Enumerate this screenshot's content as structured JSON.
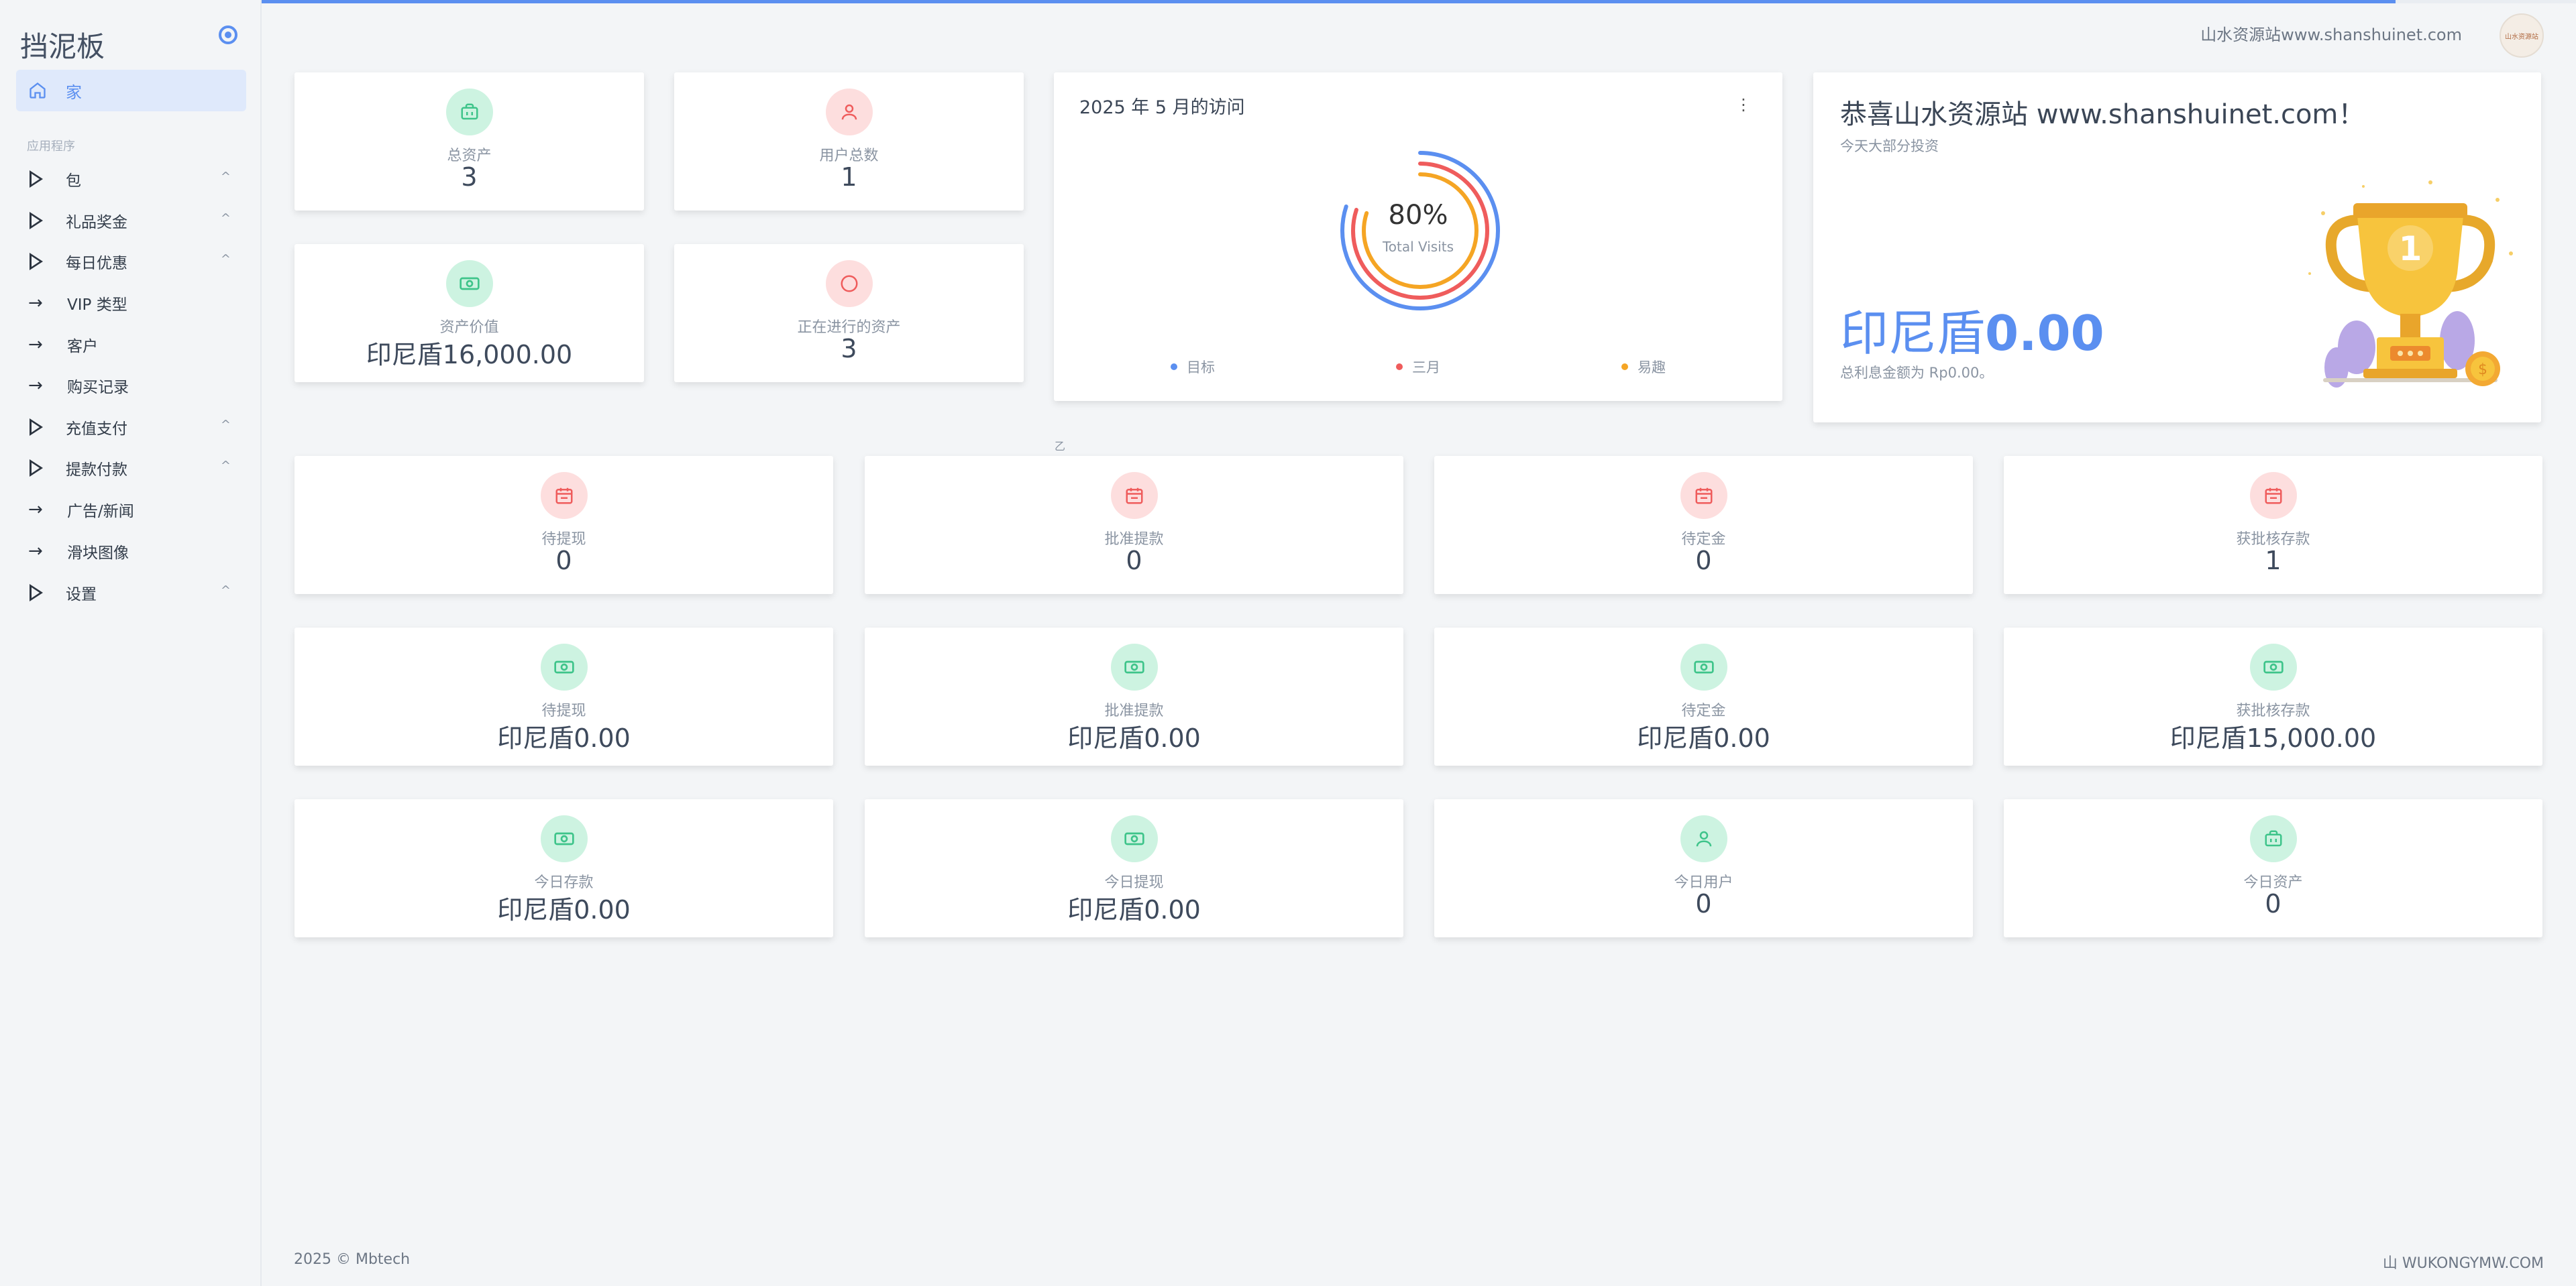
{
  "progress": 0.93,
  "sidebar": {
    "brand": "挡泥板",
    "home_label": "家",
    "section_title": "应用程序",
    "items": [
      {
        "label": "包",
        "icon": "play-triangle-icon",
        "expandable": true
      },
      {
        "label": "礼品奖金",
        "icon": "play-triangle-icon",
        "expandable": true
      },
      {
        "label": "每日优惠",
        "icon": "play-triangle-icon",
        "expandable": true
      },
      {
        "label": "VIP 类型",
        "icon": "arrow-right-icon",
        "expandable": false
      },
      {
        "label": "客户",
        "icon": "arrow-right-icon",
        "expandable": false
      },
      {
        "label": "购买记录",
        "icon": "arrow-right-icon",
        "expandable": false
      },
      {
        "label": "充值支付",
        "icon": "play-triangle-icon",
        "expandable": true
      },
      {
        "label": "提款付款",
        "icon": "play-triangle-icon",
        "expandable": true
      },
      {
        "label": "广告/新闻",
        "icon": "arrow-right-icon",
        "expandable": false
      },
      {
        "label": "滑块图像",
        "icon": "arrow-right-icon",
        "expandable": false
      },
      {
        "label": "设置",
        "icon": "play-triangle-icon",
        "expandable": true
      }
    ]
  },
  "header": {
    "site_text": "山水资源站www.shanshuinet.com",
    "avatar_text": "山水资源站"
  },
  "top_stats": [
    {
      "label": "总资产",
      "value": "3",
      "icon": "briefcase-icon",
      "color": "green"
    },
    {
      "label": "用户总数",
      "value": "1",
      "icon": "user-icon",
      "color": "red"
    },
    {
      "label": "资产价值",
      "value": "印尼盾16,000.00",
      "icon": "money-icon",
      "color": "green"
    },
    {
      "label": "正在进行的资产",
      "value": "3",
      "icon": "circle-icon",
      "color": "red"
    }
  ],
  "visits": {
    "title": "2025 年 5 月的访问",
    "percent": "80%",
    "subtitle": "Total Visits",
    "menu_icon": "more-vertical-icon",
    "rings": [
      {
        "name": "目标",
        "color": "#5b8ff0",
        "value": 0.8
      },
      {
        "name": "三月",
        "color": "#ef5c5c",
        "value": 0.8
      },
      {
        "name": "易趣",
        "color": "#f5a524",
        "value": 0.8
      }
    ]
  },
  "congrats": {
    "title": "恭喜山水资源站 www.shanshuinet.com！",
    "subtitle": "今天大部分投资",
    "amount_prefix": "印尼盾",
    "amount_value": "0.00",
    "note": "总利息金额为 Rp0.00。",
    "trophy_number": "1"
  },
  "stray_text": "乙",
  "grid_stats": [
    {
      "label": "待提现",
      "value": "0",
      "icon": "calendar-icon",
      "color": "red"
    },
    {
      "label": "批准提款",
      "value": "0",
      "icon": "calendar-icon",
      "color": "red"
    },
    {
      "label": "待定金",
      "value": "0",
      "icon": "calendar-icon",
      "color": "red"
    },
    {
      "label": "获批核存款",
      "value": "1",
      "icon": "calendar-icon",
      "color": "red"
    },
    {
      "label": "待提现",
      "value": "印尼盾0.00",
      "icon": "money-icon",
      "color": "green"
    },
    {
      "label": "批准提款",
      "value": "印尼盾0.00",
      "icon": "money-icon",
      "color": "green"
    },
    {
      "label": "待定金",
      "value": "印尼盾0.00",
      "icon": "money-icon",
      "color": "green"
    },
    {
      "label": "获批核存款",
      "value": "印尼盾15,000.00",
      "icon": "money-icon",
      "color": "green"
    },
    {
      "label": "今日存款",
      "value": "印尼盾0.00",
      "icon": "money-icon",
      "color": "green"
    },
    {
      "label": "今日提现",
      "value": "印尼盾0.00",
      "icon": "money-icon",
      "color": "green"
    },
    {
      "label": "今日用户",
      "value": "0",
      "icon": "user-icon",
      "color": "green"
    },
    {
      "label": "今日资产",
      "value": "0",
      "icon": "briefcase-icon",
      "color": "green"
    }
  ],
  "footer": {
    "copyright": "2025 © Mbtech",
    "right": "山 WUKONGYMW.COM"
  }
}
